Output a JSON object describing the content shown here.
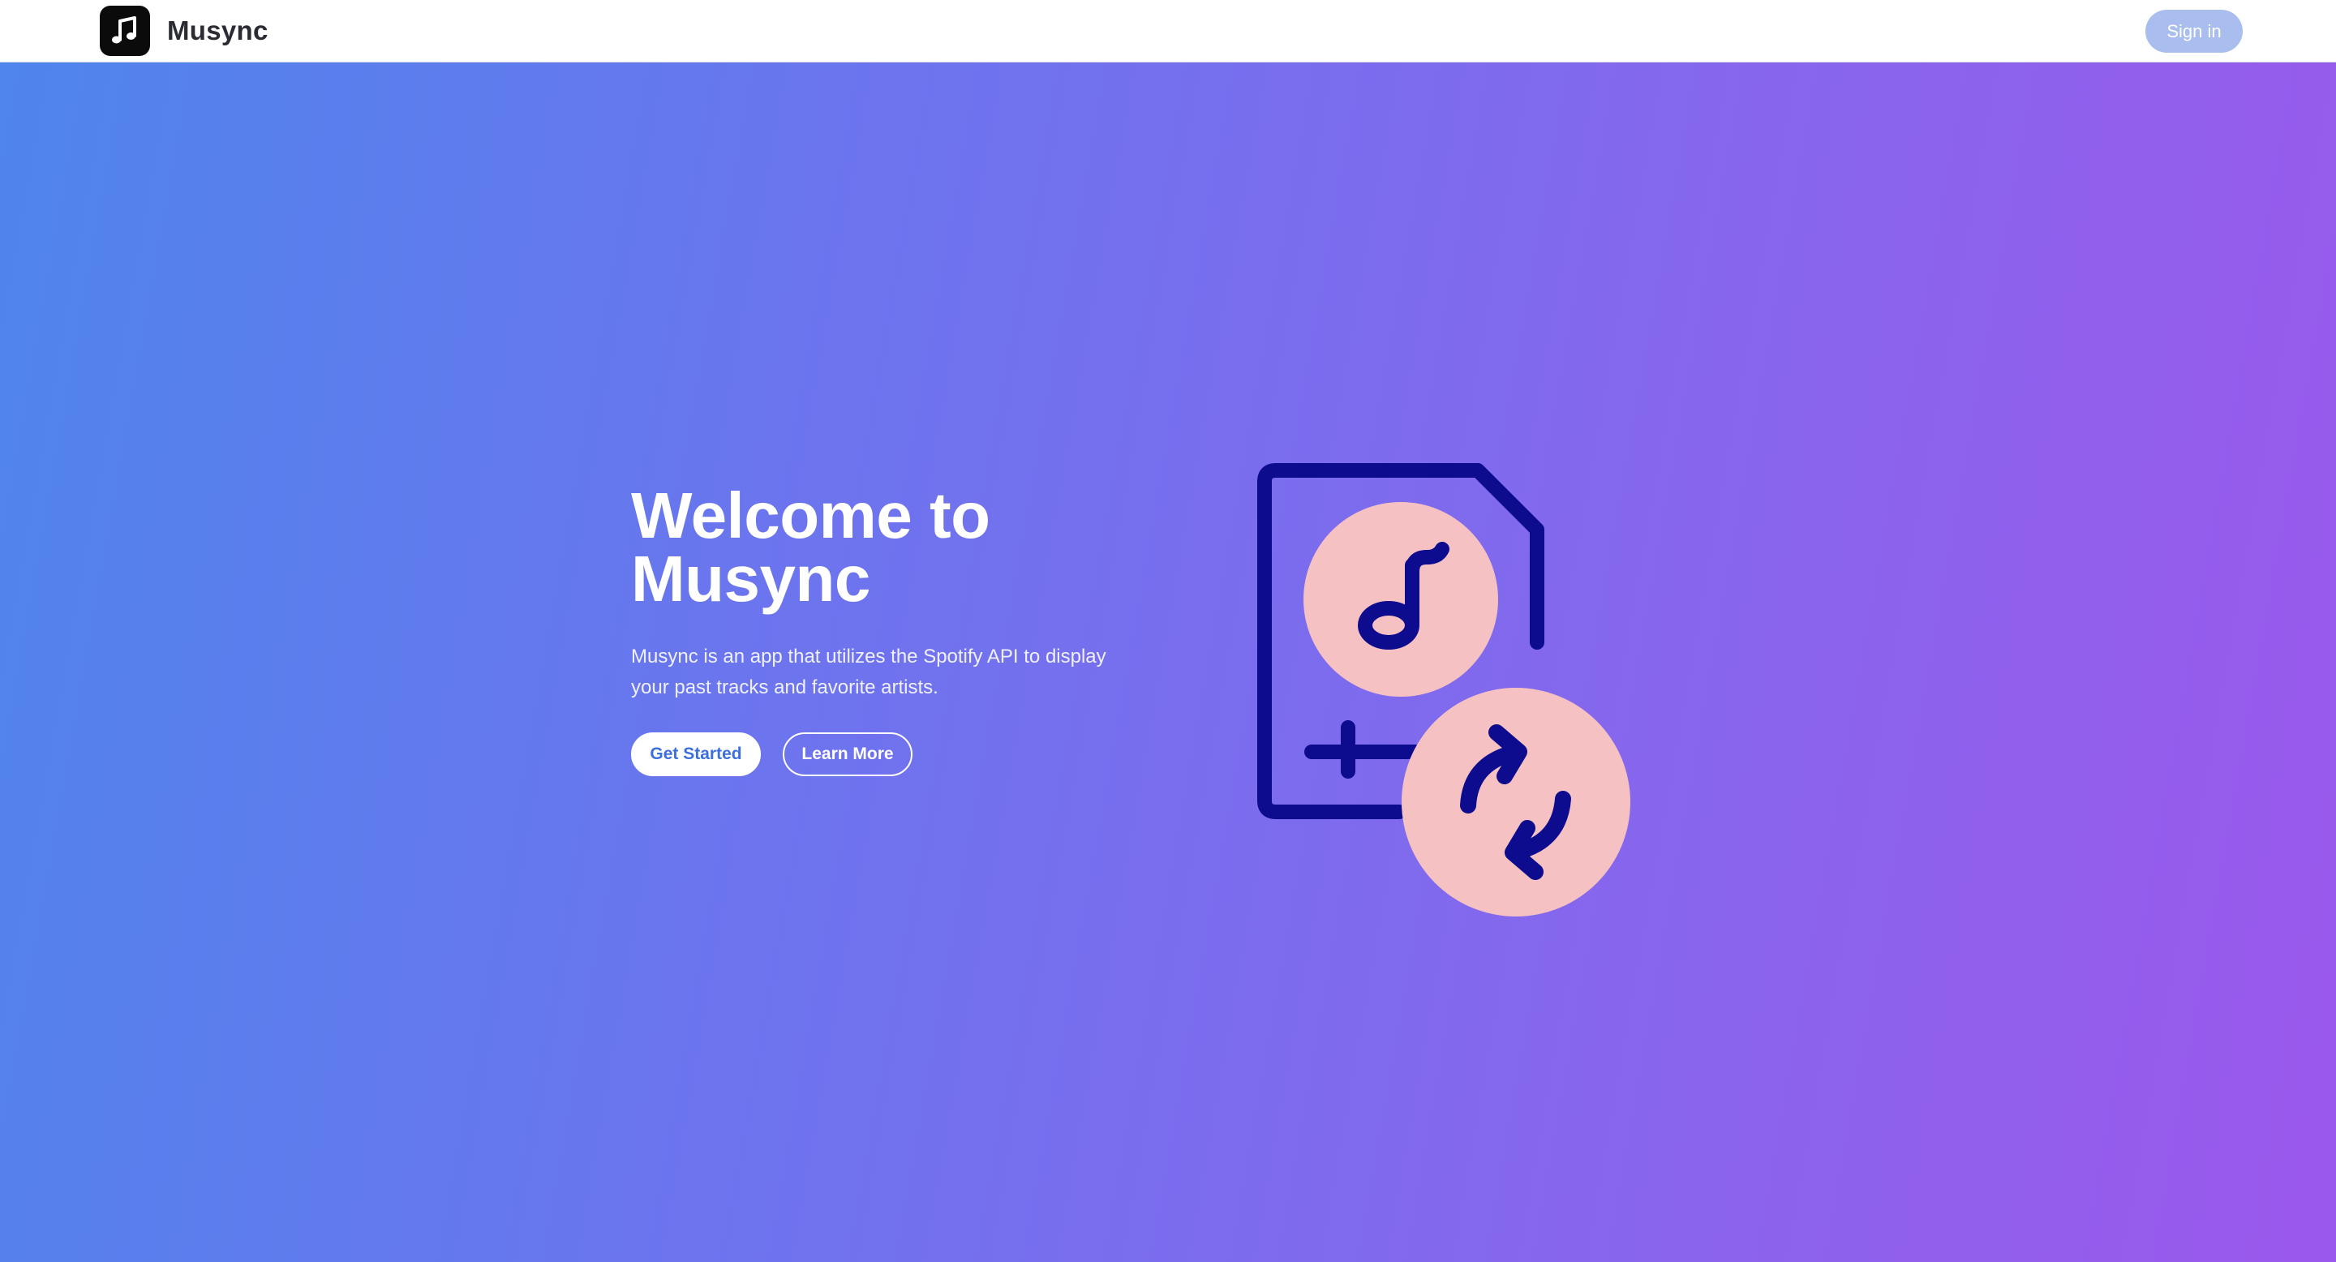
{
  "header": {
    "brand_name": "Musync",
    "logo_icon": "music-note-icon",
    "signin_label": "Sign in"
  },
  "hero": {
    "title_line1": "Welcome to",
    "title_line2": "Musync",
    "description": "Musync is an app that utilizes the Spotify API to display your past tracks and favorite artists.",
    "primary_cta": "Get Started",
    "secondary_cta": "Learn More",
    "illustration_icon": "music-file-sync-icon"
  },
  "colors": {
    "gradient_start": "#4f85ec",
    "gradient_end": "#9b58ec",
    "illustration_stroke": "#0d0c8f",
    "illustration_fill": "#f5c1c2",
    "signin_bg": "#a9bdee"
  }
}
